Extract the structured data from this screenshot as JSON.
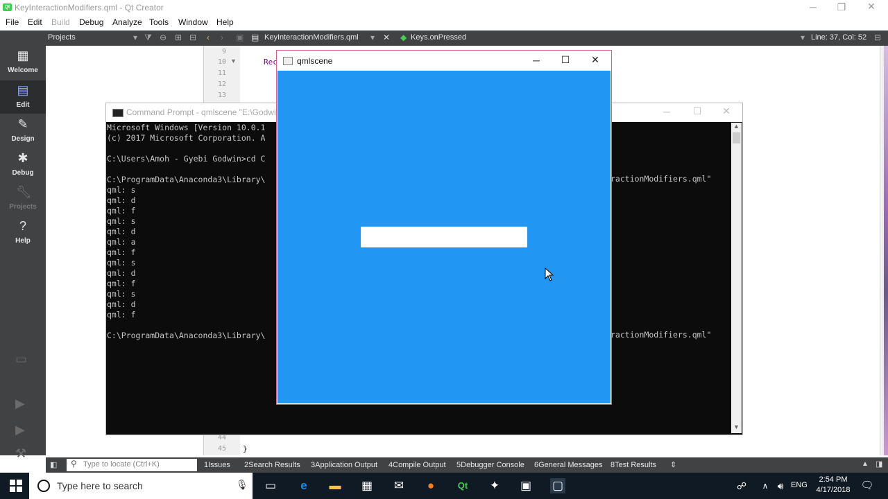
{
  "qt_window": {
    "title": "KeyInteractionModifiers.qml - Qt Creator",
    "logo_text": "Qt"
  },
  "menu": [
    "File",
    "Edit",
    "Build",
    "Debug",
    "Analyze",
    "Tools",
    "Window",
    "Help"
  ],
  "toolbar": {
    "projects_label": "Projects",
    "file_tab": "KeyInteractionModifiers.qml",
    "symbol": "Keys.onPressed",
    "cursor_pos": "Line: 37, Col: 52"
  },
  "modes": [
    {
      "label": "Welcome",
      "icon": "welcome-grid-icon"
    },
    {
      "label": "Edit",
      "icon": "edit-document-icon"
    },
    {
      "label": "Design",
      "icon": "design-pen-icon"
    },
    {
      "label": "Debug",
      "icon": "debug-bug-icon"
    },
    {
      "label": "Projects",
      "icon": "projects-wrench-icon"
    },
    {
      "label": "Help",
      "icon": "help-question-icon"
    }
  ],
  "editor": {
    "line_numbers_top": [
      "9",
      "10",
      "11",
      "12",
      "13"
    ],
    "line_numbers_bottom": [
      "44",
      "45"
    ],
    "code_fragment": "Rec",
    "closing_brace": "}"
  },
  "cmd_window": {
    "title": "Command Prompt - qmlscene  \"E:\\Godwin\\",
    "lines": [
      "Microsoft Windows [Version 10.0.1",
      "(c) 2017 Microsoft Corporation. A",
      "",
      "C:\\Users\\Amoh - Gyebi Godwin>cd C",
      "",
      "C:\\ProgramData\\Anaconda3\\Library\\",
      "qml: s",
      "qml: d",
      "qml: f",
      "qml: s",
      "qml: d",
      "qml: a",
      "qml: f",
      "qml: s",
      "qml: d",
      "qml: f",
      "qml: s",
      "qml: d",
      "qml: f",
      "",
      "C:\\ProgramData\\Anaconda3\\Library\\"
    ],
    "right_fragment_1": "ractionModifiers.qml\"",
    "right_fragment_2": "ractionModifiers.qml\""
  },
  "qml_window": {
    "title": "qmlscene",
    "scene_color": "#2196f3",
    "input_value": ""
  },
  "output_pane": {
    "locator_placeholder": "Type to locate (Ctrl+K)",
    "tabs": [
      {
        "num": "1",
        "label": "Issues"
      },
      {
        "num": "2",
        "label": "Search Results"
      },
      {
        "num": "3",
        "label": "Application Output"
      },
      {
        "num": "4",
        "label": "Compile Output"
      },
      {
        "num": "5",
        "label": "Debugger Console"
      },
      {
        "num": "6",
        "label": "General Messages"
      },
      {
        "num": "8",
        "label": "Test Results"
      }
    ]
  },
  "taskbar": {
    "search_placeholder": "Type here to search",
    "language": "ENG",
    "time": "2:54 PM",
    "date": "4/17/2018"
  }
}
